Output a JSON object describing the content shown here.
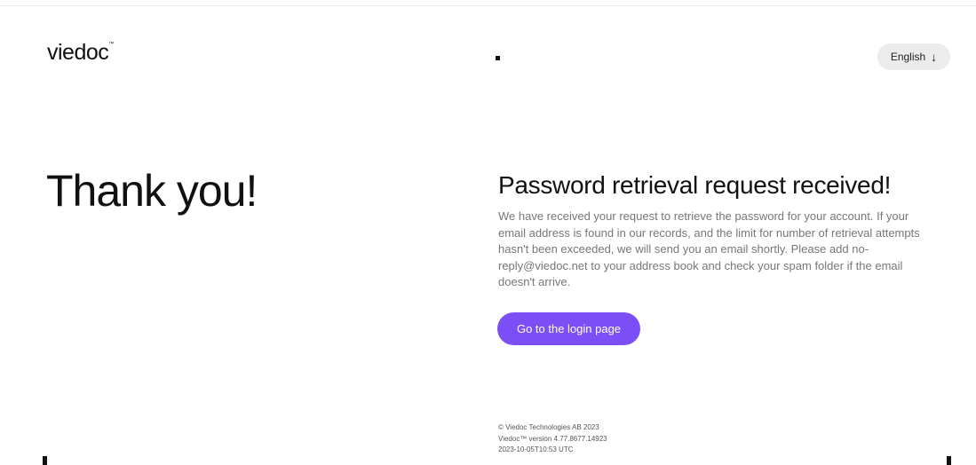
{
  "header": {
    "logo_text": "viedoc",
    "logo_mark": "™",
    "language": {
      "label": "English",
      "icon": "arrow-down-icon"
    }
  },
  "main": {
    "left_heading": "Thank you!",
    "title": "Password retrieval request received!",
    "message": "We have received your request to retrieve the password for your account. If your email address is found in our records, and the limit for number of retrieval attempts hasn't been exceeded, we will send you an email shortly. Please add no-reply@viedoc.net to your address book and check your spam folder if the email doesn't arrive.",
    "login_button": "Go to the login page"
  },
  "footer": {
    "copyright": "© Viedoc Technologies AB 2023",
    "version": "Viedoc™ version 4.77.8677.14923",
    "timestamp": "2023-10-05T10:53 UTC"
  },
  "colors": {
    "accent": "#7b4ff5",
    "text": "#111111",
    "muted": "#777777",
    "pill_bg": "#ececec"
  }
}
